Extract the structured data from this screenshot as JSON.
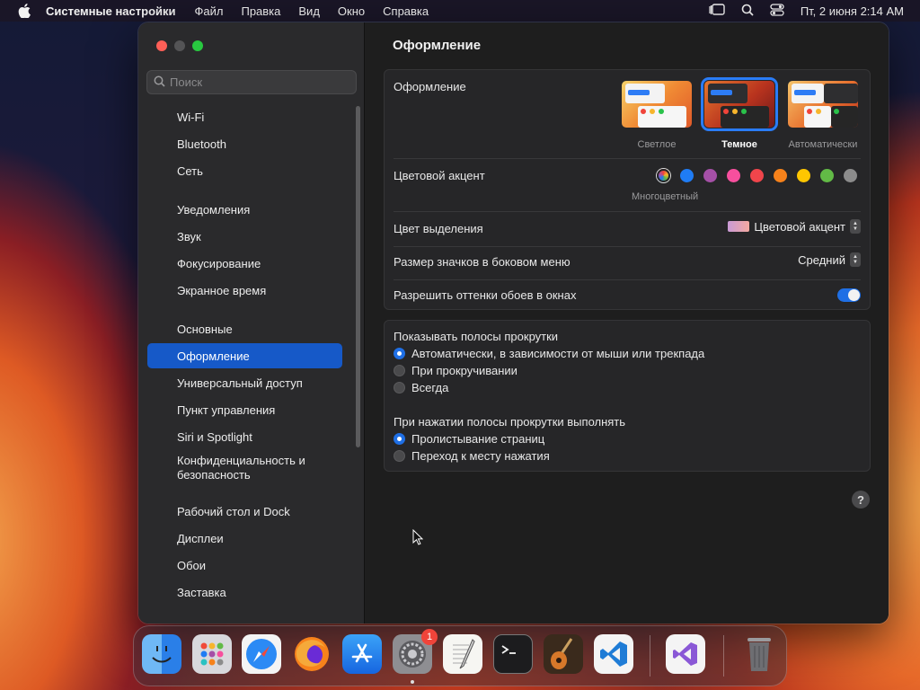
{
  "menubar": {
    "app_name": "Системные настройки",
    "items": [
      "Файл",
      "Правка",
      "Вид",
      "Окно",
      "Справка"
    ],
    "clock": "Пт, 2 июня  2:14 AM"
  },
  "sidebar": {
    "search_placeholder": "Поиск",
    "items": [
      {
        "label": "Wi-Fi"
      },
      {
        "label": "Bluetooth"
      },
      {
        "label": "Сеть"
      },
      {
        "label": "Уведомления"
      },
      {
        "label": "Звук"
      },
      {
        "label": "Фокусирование"
      },
      {
        "label": "Экранное время"
      },
      {
        "label": "Основные"
      },
      {
        "label": "Оформление",
        "active": true
      },
      {
        "label": "Универсальный доступ"
      },
      {
        "label": "Пункт управления"
      },
      {
        "label": "Siri и Spotlight"
      },
      {
        "label": "Конфиденциальность и безопасность"
      },
      {
        "label": "Рабочий стол и Dock"
      },
      {
        "label": "Дисплеи"
      },
      {
        "label": "Обои"
      },
      {
        "label": "Заставка"
      }
    ]
  },
  "content": {
    "title": "Оформление",
    "appearance": {
      "label": "Оформление",
      "options": [
        {
          "label": "Светлое",
          "selected": false
        },
        {
          "label": "Темное",
          "selected": true
        },
        {
          "label": "Автоматически",
          "selected": false
        }
      ]
    },
    "accent": {
      "label": "Цветовой акцент",
      "caption": "Многоцветный",
      "colors": [
        "#d6d6d6",
        "#1f7cf4",
        "#a550a7",
        "#f74f9e",
        "#f0454b",
        "#f7821b",
        "#ffc600",
        "#62ba46",
        "#8c8c8c"
      ]
    },
    "highlight": {
      "label": "Цвет выделения",
      "value": "Цветовой акцент"
    },
    "icon_size": {
      "label": "Размер значков в боковом меню",
      "value": "Средний"
    },
    "wallpaper_tint": {
      "label": "Разрешить оттенки обоев в окнах",
      "enabled": true
    },
    "scrollbars": {
      "title": "Показывать полосы прокрутки",
      "options": [
        {
          "label": "Автоматически, в зависимости от мыши или трекпада",
          "selected": true
        },
        {
          "label": "При прокручивании",
          "selected": false
        },
        {
          "label": "Всегда",
          "selected": false
        }
      ]
    },
    "click": {
      "title": "При нажатии полосы прокрутки выполнять",
      "options": [
        {
          "label": "Пролистывание страниц",
          "selected": true
        },
        {
          "label": "Переход к месту нажатия",
          "selected": false
        }
      ]
    },
    "help_label": "?"
  },
  "dock": {
    "apps": [
      {
        "name": "finder-icon"
      },
      {
        "name": "launchpad-icon"
      },
      {
        "name": "safari-icon"
      },
      {
        "name": "firefox-icon"
      },
      {
        "name": "app-store-icon"
      },
      {
        "name": "system-settings-icon",
        "badge": "1"
      },
      {
        "name": "textedit-icon"
      },
      {
        "name": "terminal-icon"
      },
      {
        "name": "garageband-icon"
      },
      {
        "name": "vscode-icon"
      },
      {
        "name": "visual-studio-icon"
      },
      {
        "name": "trash-icon"
      }
    ]
  }
}
